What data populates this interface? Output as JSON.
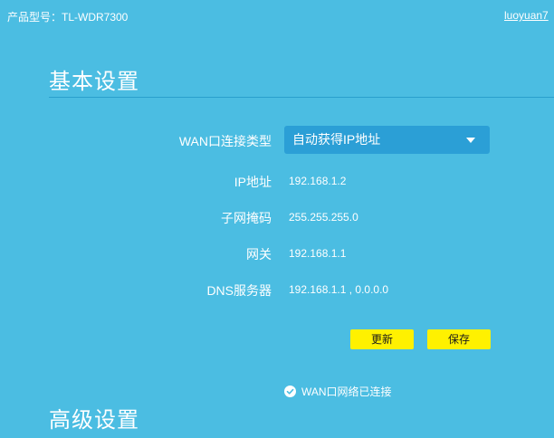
{
  "header": {
    "model_label": "产品型号：TL-WDR7300",
    "user": "luoyuan7"
  },
  "basic": {
    "title": "基本设置",
    "wan_type_label": "WAN口连接类型",
    "wan_type_value": "自动获得IP地址",
    "ip_label": "IP地址",
    "ip_value": "192.168.1.2",
    "mask_label": "子网掩码",
    "mask_value": "255.255.255.0",
    "gateway_label": "网关",
    "gateway_value": "192.168.1.1",
    "dns_label": "DNS服务器",
    "dns_value": "192.168.1.1 , 0.0.0.0",
    "refresh_label": "更新",
    "save_label": "保存",
    "status_text": "WAN口网络已连接",
    "status_icon": "check-circle-icon"
  },
  "advanced": {
    "title": "高级设置"
  },
  "colors": {
    "background": "#4bbde2",
    "select_bg": "#2b9fd6",
    "button_bg": "#fff100"
  }
}
